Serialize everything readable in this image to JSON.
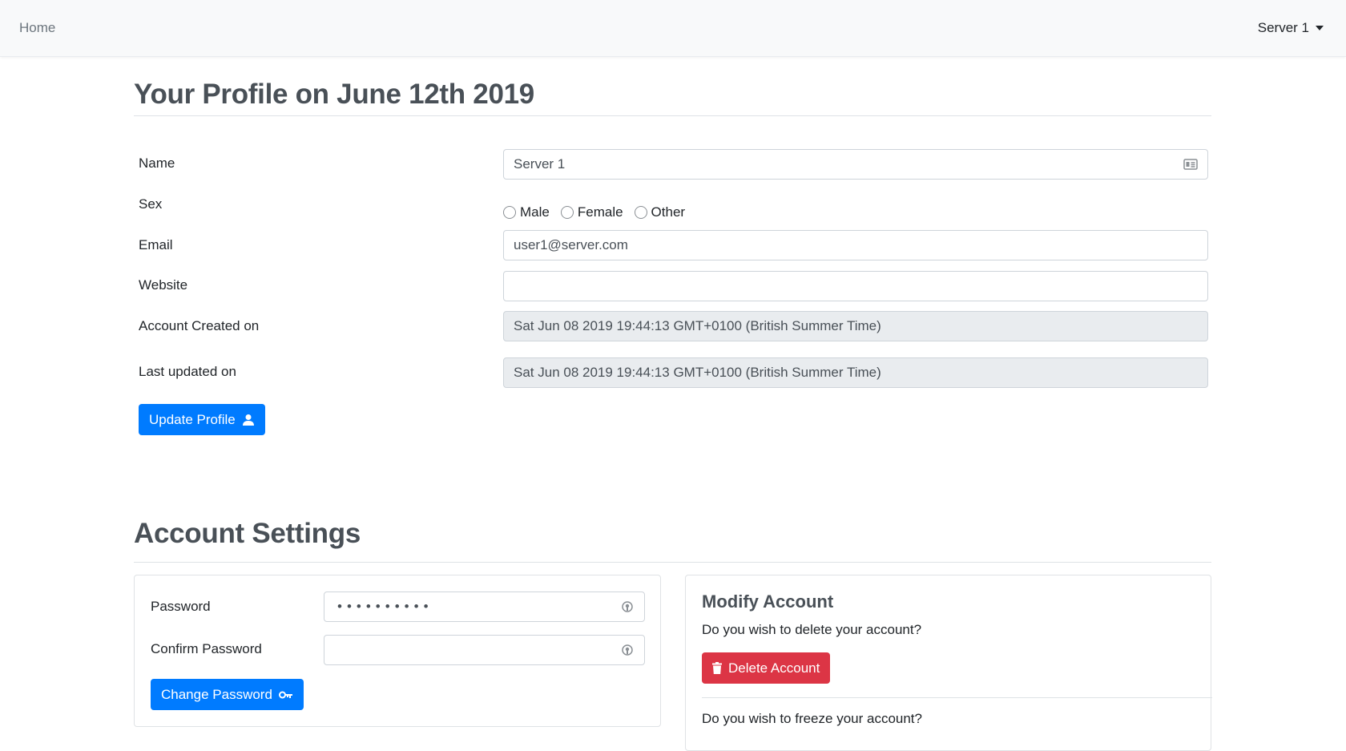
{
  "navbar": {
    "home_label": "Home",
    "server_label": "Server 1"
  },
  "profile": {
    "title": "Your Profile on June 12th 2019",
    "name_label": "Name",
    "name_value": "Server 1",
    "sex_label": "Sex",
    "sex_options": [
      "Male",
      "Female",
      "Other"
    ],
    "email_label": "Email",
    "email_value": "user1@server.com",
    "website_label": "Website",
    "website_value": "",
    "created_label": "Account Created on",
    "created_value": "Sat Jun 08 2019 19:44:13 GMT+0100 (British Summer Time)",
    "updated_label": "Last updated on",
    "updated_value": "Sat Jun 08 2019 19:44:13 GMT+0100 (British Summer Time)",
    "update_button": "Update Profile"
  },
  "settings": {
    "title": "Account Settings",
    "password_label": "Password",
    "password_value": "••••••••••",
    "confirm_label": "Confirm Password",
    "confirm_value": "",
    "change_button": "Change Password",
    "modify_title": "Modify Account",
    "delete_question": "Do you wish to delete your account?",
    "delete_button": "Delete Account",
    "freeze_question": "Do you wish to freeze your account?"
  },
  "colors": {
    "primary": "#007bff",
    "danger": "#dc3545",
    "navbar_bg": "#f8f9fa"
  },
  "icons": {
    "name_field": "id-card-icon",
    "password_field": "eye-icon",
    "update": "user-icon",
    "change_password": "key-icon",
    "delete": "trash-icon",
    "dropdown": "caret-down-icon"
  }
}
